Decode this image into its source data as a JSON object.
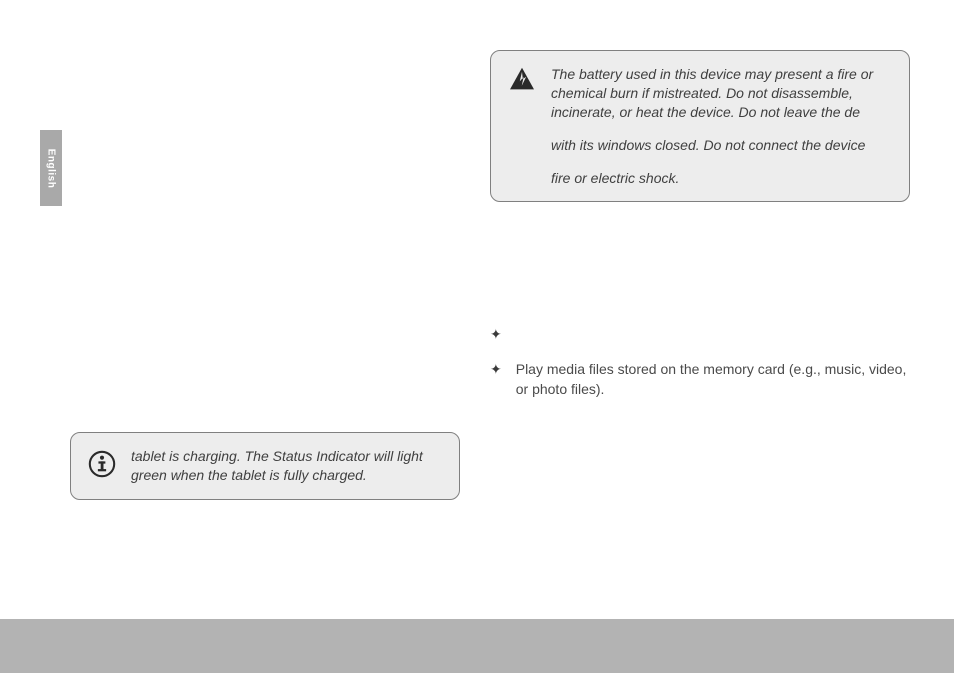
{
  "side_tab": {
    "label": "English"
  },
  "info_callout": {
    "lines": [
      "tablet is charging. The Status Indicator will light green when the tablet is fully charged."
    ]
  },
  "warning_callout": {
    "lines": [
      "The battery used in this device may present a fire or chemical burn if mistreated. Do not disassemble, incinerate, or heat the device. Do not leave the de",
      "with its windows closed. Do not connect the device",
      "fire or electric shock."
    ]
  },
  "memory_section": {
    "bullets": [
      {
        "text": ""
      },
      {
        "text": "Play media files stored on the memory card (e.g., music, video, or photo files)."
      }
    ]
  }
}
